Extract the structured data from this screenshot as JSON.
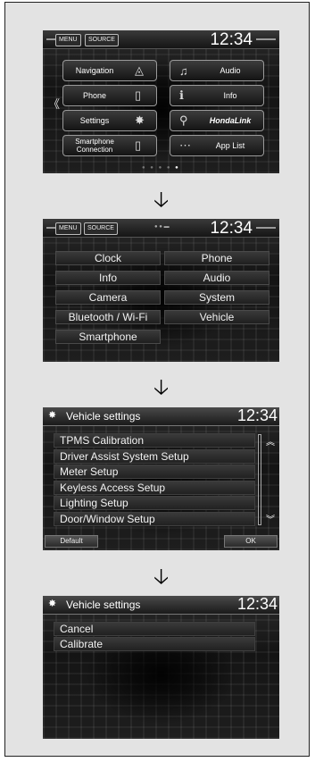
{
  "screen1": {
    "menu": "MENU",
    "source": "SOURCE",
    "clock": "12:34",
    "left": [
      {
        "label": "Navigation",
        "icon": "compass-icon",
        "glyph": "◬"
      },
      {
        "label": "Phone",
        "icon": "phone-icon",
        "glyph": "▯"
      },
      {
        "label": "Settings",
        "icon": "gear-icon",
        "glyph": "✸"
      },
      {
        "label": "Smartphone Connection",
        "icon": "smartphone-icon",
        "glyph": "▯"
      }
    ],
    "right": [
      {
        "label": "Audio",
        "icon": "music-note-icon",
        "glyph": "♫"
      },
      {
        "label": "Info",
        "icon": "info-icon",
        "glyph": "ℹ"
      },
      {
        "label": "HondaLink",
        "icon": "hondalink-icon",
        "glyph": "⚲"
      },
      {
        "label": "App List",
        "icon": "app-list-icon",
        "glyph": "⋯"
      }
    ],
    "back_glyph": "《"
  },
  "screen2": {
    "menu": "MENU",
    "source": "SOURCE",
    "clock": "12:34",
    "items": [
      "Clock",
      "Phone",
      "Info",
      "Audio",
      "Camera",
      "System",
      "Bluetooth / Wi-Fi",
      "Vehicle",
      "Smartphone"
    ]
  },
  "screen3": {
    "title": "Vehicle settings",
    "clock": "12:34",
    "items": [
      "TPMS Calibration",
      "Driver Assist System Setup",
      "Meter Setup",
      "Keyless Access Setup",
      "Lighting Setup",
      "Door/Window Setup"
    ],
    "default_label": "Default",
    "ok_label": "OK",
    "scroll_up_glyph": "︽",
    "scroll_down_glyph": "︾"
  },
  "screen4": {
    "title": "Vehicle settings",
    "clock": "12:34",
    "items": [
      "Cancel",
      "Calibrate"
    ]
  },
  "arrow_glyph": "🡣"
}
